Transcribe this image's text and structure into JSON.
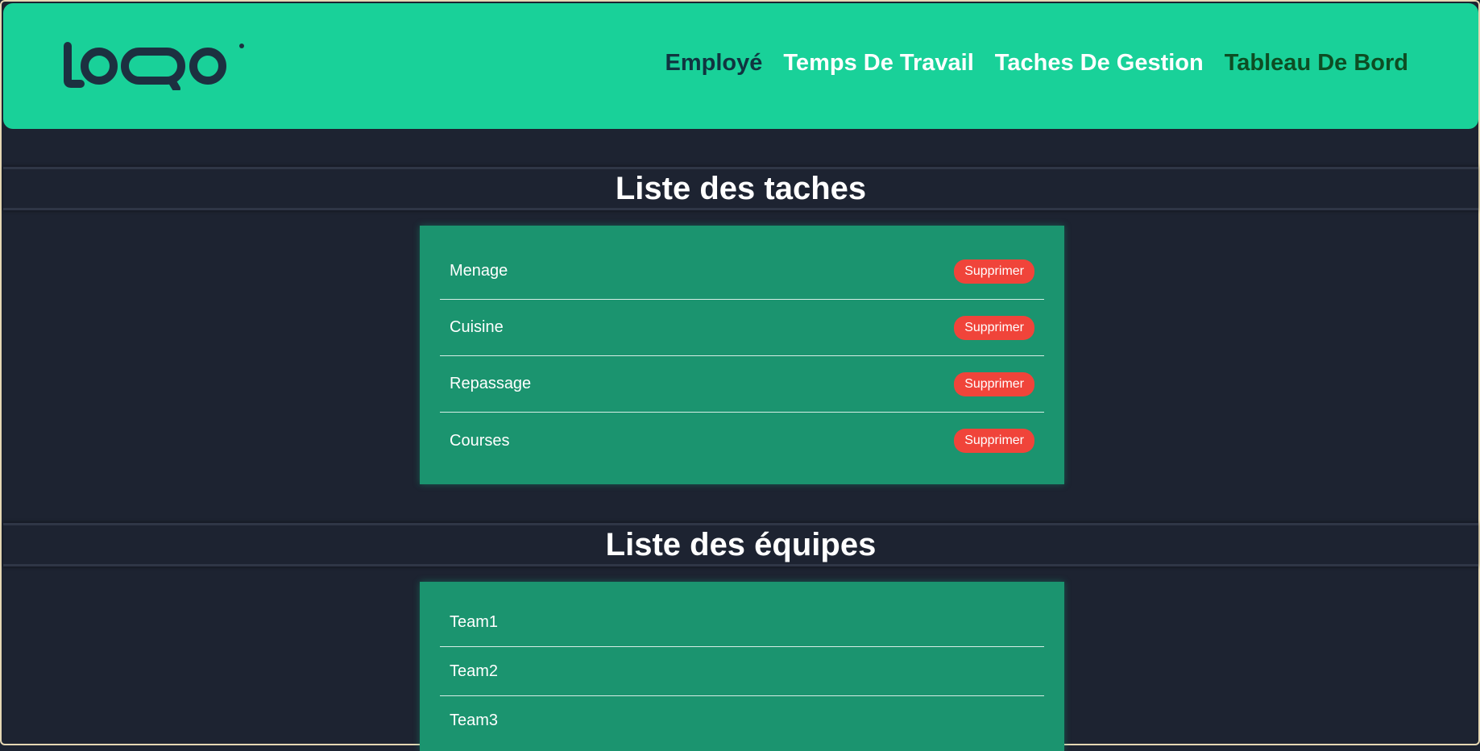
{
  "header": {
    "logo_alt": "logo",
    "nav": [
      {
        "label": "Employé"
      },
      {
        "label": "Temps De Travail"
      },
      {
        "label": "Taches De Gestion"
      },
      {
        "label": "Tableau De Bord"
      }
    ]
  },
  "tasks": {
    "title": "Liste des taches",
    "delete_label": "Supprimer",
    "items": [
      {
        "name": "Menage"
      },
      {
        "name": "Cuisine"
      },
      {
        "name": "Repassage"
      },
      {
        "name": "Courses"
      }
    ]
  },
  "teams": {
    "title": "Liste des équipes",
    "items": [
      {
        "name": "Team1"
      },
      {
        "name": "Team2"
      },
      {
        "name": "Team3"
      }
    ]
  },
  "colors": {
    "header_bg": "#19d199",
    "page_bg": "#1d2331",
    "card_bg": "#1b946f",
    "delete_bg": "#f0443a",
    "active_nav": "#0d4d23"
  }
}
